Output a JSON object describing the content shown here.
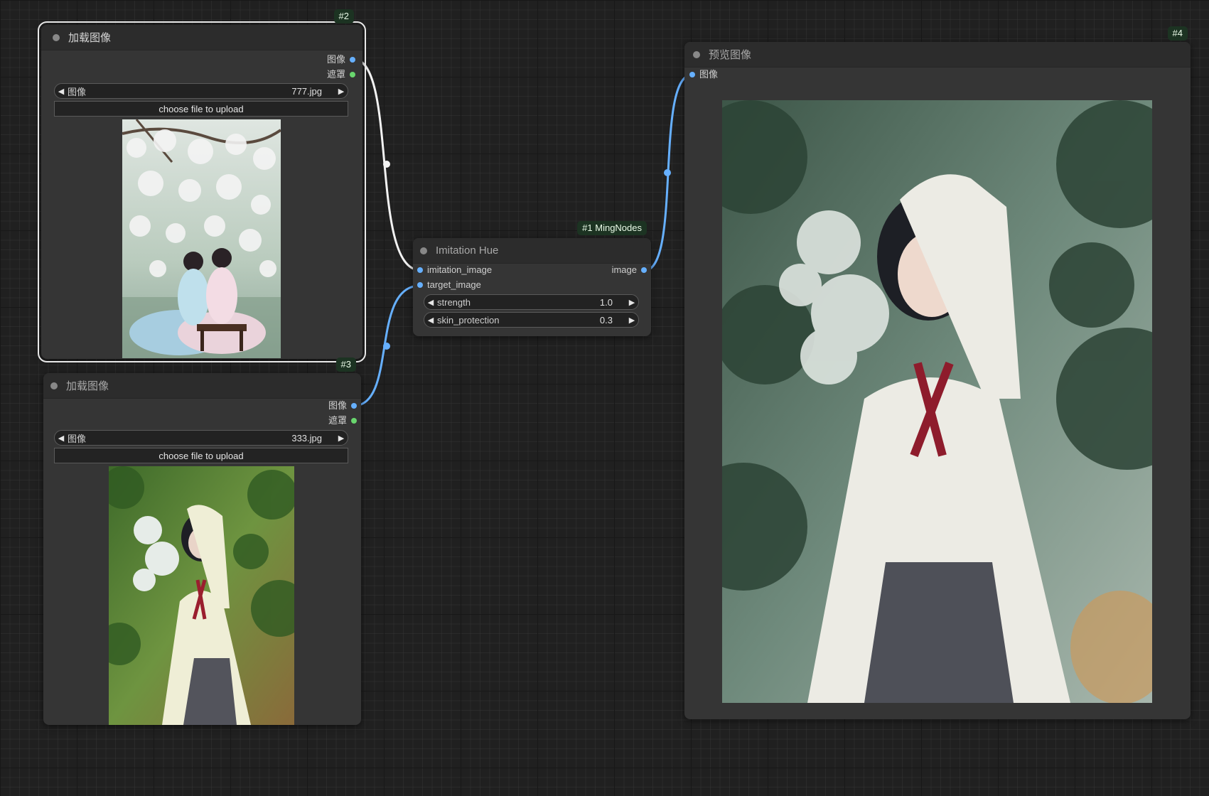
{
  "nodes": {
    "load1": {
      "id_badge": "#2",
      "title": "加载图像",
      "outputs": [
        "图像",
        "遮罩"
      ],
      "image_widget": {
        "label": "图像",
        "value": "777.jpg"
      },
      "upload_label": "choose file to upload"
    },
    "load2": {
      "id_badge": "#3",
      "title": "加载图像",
      "outputs": [
        "图像",
        "遮罩"
      ],
      "image_widget": {
        "label": "图像",
        "value": "333.jpg"
      },
      "upload_label": "choose file to upload"
    },
    "imitation": {
      "id_badge": "#1 MingNodes",
      "title": "Imitation Hue",
      "inputs": [
        "imitation_image",
        "target_image"
      ],
      "output": "image",
      "widgets": [
        {
          "label": "strength",
          "value": "1.0"
        },
        {
          "label": "skin_protection",
          "value": "0.3"
        }
      ]
    },
    "preview": {
      "id_badge": "#4",
      "title": "预览图像",
      "input": "图像"
    }
  },
  "colors": {
    "canvas_bg": "#202020",
    "node_bg": "#353535",
    "image_slot": "#66b0ff",
    "mask_slot": "#69d66e",
    "badge_bg": "#1c3322"
  },
  "icons": {
    "decrement": "left-triangle",
    "increment": "right-triangle"
  }
}
